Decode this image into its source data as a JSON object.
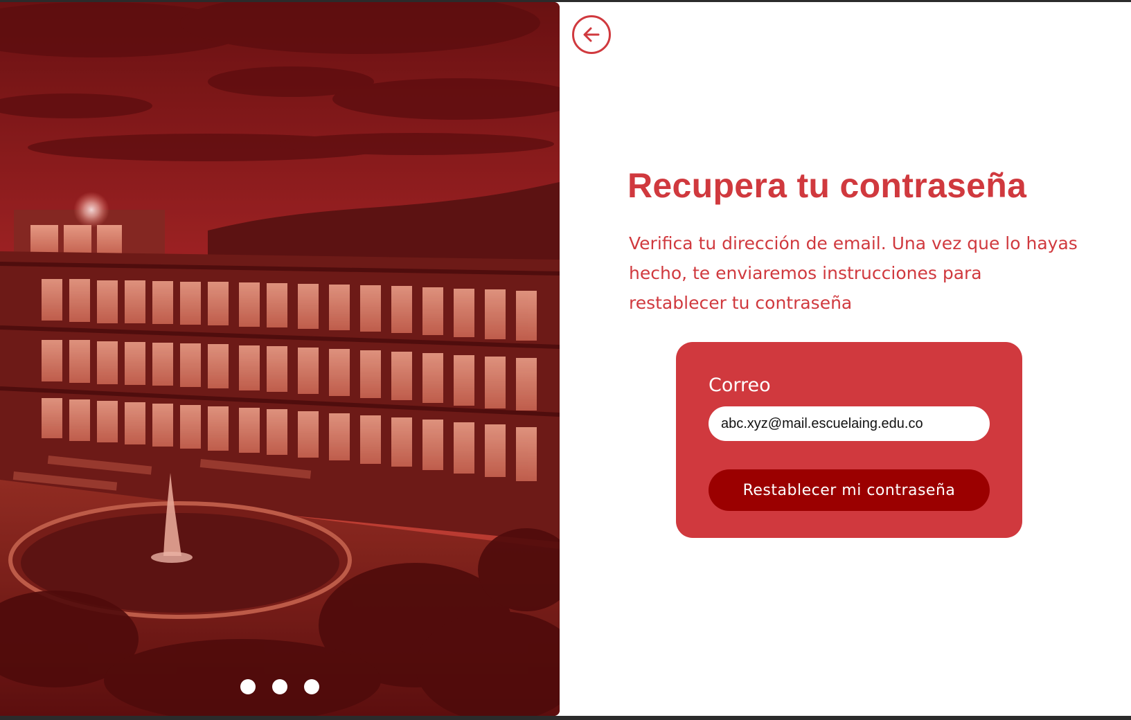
{
  "hero": {
    "image": "campus-building-with-fountain-red-tint",
    "overlay_color": "#b21e1e",
    "carousel_dots": 3
  },
  "back": {
    "icon": "arrow-left-icon"
  },
  "content": {
    "title": "Recupera tu contraseña",
    "subtitle": "Verifica tu dirección de email. Una vez que lo hayas hecho, te enviaremos instrucciones para restablecer tu contraseña"
  },
  "form": {
    "email_label": "Correo",
    "email_value": "abc.xyz@mail.escuelaing.edu.co",
    "submit_label": "Restablecer mi contraseña"
  },
  "colors": {
    "accent": "#d0393e",
    "button_dark": "#9b0000",
    "white": "#ffffff"
  }
}
